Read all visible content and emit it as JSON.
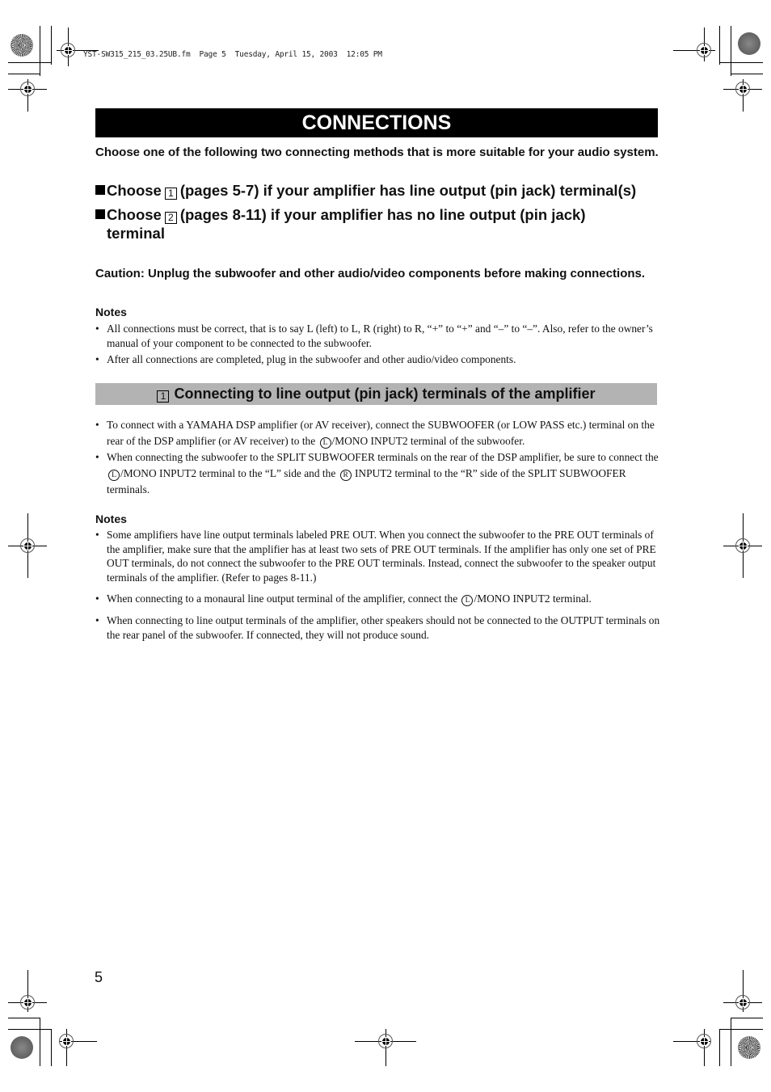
{
  "header": {
    "file_info": "YST-SW315_215_03.25UB.fm  Page 5  Tuesday, April 15, 2003  12:05 PM"
  },
  "title": "CONNECTIONS",
  "intro": "Choose one of the following two connecting methods that is more suitable for your audio system.",
  "choices": [
    {
      "prefix": "Choose",
      "number": "1",
      "text": "(pages 5-7) if your amplifier has line output (pin jack) terminal(s)"
    },
    {
      "prefix": "Choose",
      "number": "2",
      "text": "(pages 8-11) if your amplifier has no line output (pin jack)",
      "continuation": "terminal"
    }
  ],
  "caution": "Caution: Unplug the subwoofer and other audio/video components before making connections.",
  "notes1": {
    "heading": "Notes",
    "items": [
      "All connections must be correct, that is to say L (left) to L, R (right) to R, “+” to “+” and “–” to “–”.  Also, refer to the owner’s manual of your component to be connected to the subwoofer.",
      "After all connections are completed, plug in the subwoofer and other audio/video components."
    ]
  },
  "section": {
    "number": "1",
    "title": "Connecting to line output (pin jack) terminals of the amplifier",
    "bullets": [
      {
        "a": "To connect with a YAMAHA DSP amplifier (or AV receiver), connect the SUBWOOFER (or LOW PASS etc.) terminal on the rear of the DSP amplifier (or AV receiver) to the ",
        "sym1": "L",
        "b": "/MONO INPUT2 terminal of the subwoofer."
      },
      {
        "a": "When connecting the subwoofer to the SPLIT SUBWOOFER terminals on the rear of the DSP amplifier, be sure to connect the ",
        "sym1": "L",
        "b": "/MONO INPUT2 terminal to the “L” side and the ",
        "sym2": "R",
        "c": " INPUT2 terminal to the “R” side of the SPLIT SUBWOOFER terminals."
      }
    ]
  },
  "notes2": {
    "heading": "Notes",
    "items": [
      {
        "a": "Some amplifiers have line output terminals labeled PRE OUT. When you connect the subwoofer to the PRE OUT terminals of the amplifier, make sure that the amplifier has at least two sets of PRE OUT terminals. If the amplifier has only one set of PRE OUT terminals, do not connect the subwoofer to the PRE OUT terminals. Instead, connect the subwoofer to the speaker output terminals of the amplifier. (Refer to pages 8-11.)"
      },
      {
        "a": "When connecting to a monaural line output terminal of the amplifier, connect the ",
        "sym1": "L",
        "b": "/MONO INPUT2 terminal."
      },
      {
        "a": "When connecting to line output terminals of the amplifier, other speakers should not be connected to the OUTPUT terminals on the rear panel of the subwoofer.  If connected, they will not produce sound."
      }
    ]
  },
  "page_number": "5"
}
